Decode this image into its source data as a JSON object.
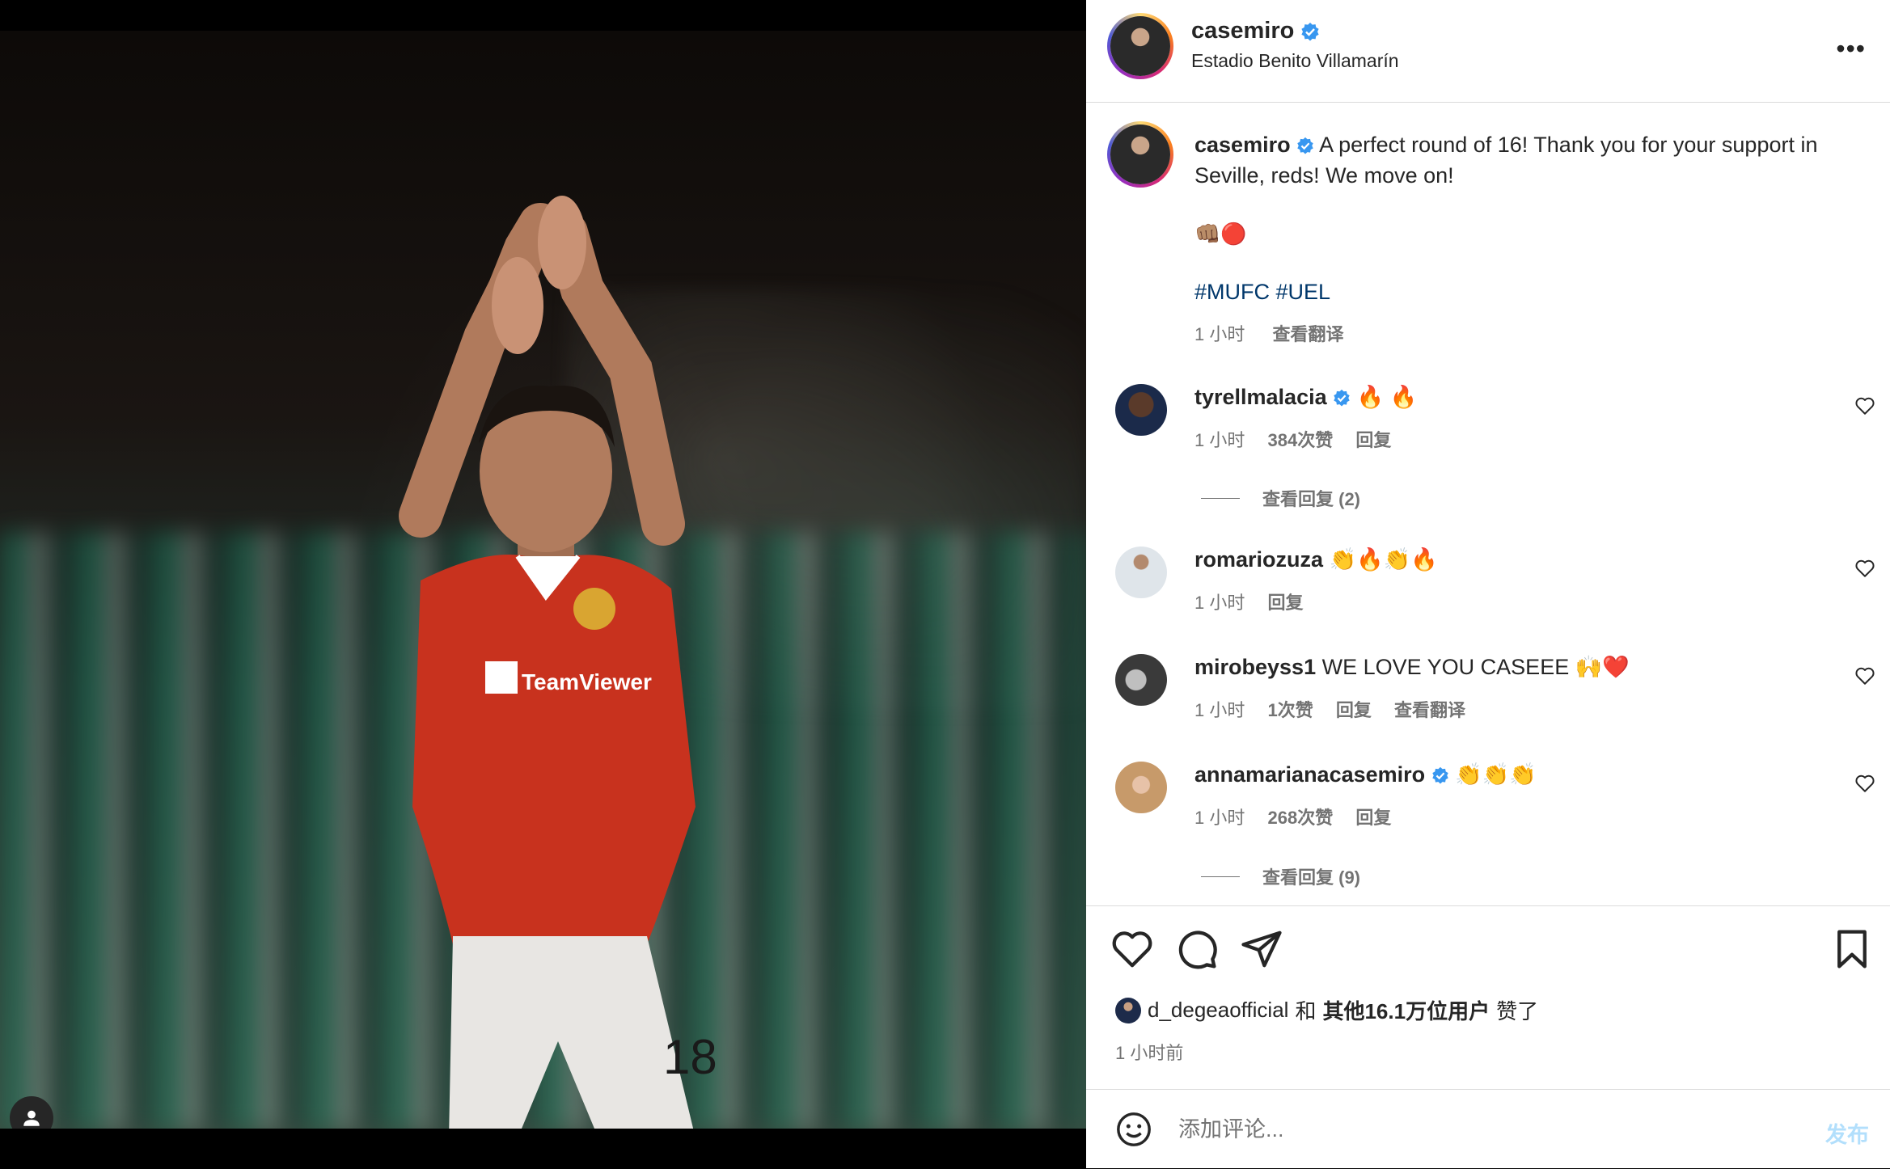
{
  "post": {
    "username": "casemiro",
    "location": "Estadio Benito Villamarín",
    "more_label": "•••",
    "caption": {
      "username": "casemiro",
      "text": "A perfect round of 16! Thank you for your support in Seville, reds! We move on!",
      "emoji": "👊🏽🔴",
      "hashtags": "#MUFC #UEL",
      "time": "1 小时",
      "translate": "查看翻译"
    }
  },
  "comments": [
    {
      "username": "tyrellmalacia",
      "verified": true,
      "text": "🔥 🔥",
      "time": "1 小时",
      "likes": "384次赞",
      "reply": "回复",
      "view_replies": "查看回复 (2)"
    },
    {
      "username": "romariozuza",
      "verified": false,
      "text": "👏🔥👏🔥",
      "time": "1 小时",
      "reply": "回复"
    },
    {
      "username": "mirobeyss1",
      "verified": false,
      "text": "WE LOVE YOU CASEEE 🙌❤️",
      "time": "1 小时",
      "likes": "1次赞",
      "reply": "回复",
      "translate": "查看翻译"
    },
    {
      "username": "annamarianacasemiro",
      "verified": true,
      "text": "👏👏👏",
      "time": "1 小时",
      "likes": "268次赞",
      "reply": "回复",
      "view_replies": "查看回复 (9)"
    }
  ],
  "likes": {
    "user": "d_degeaofficial",
    "and": "和",
    "others": "其他16.1万位用户",
    "suffix": "赞了"
  },
  "time_ago": "1 小时前",
  "comment_box": {
    "placeholder": "添加评论...",
    "post_label": "发布"
  },
  "colors": {
    "verified": "#3897f0",
    "link": "#00376b",
    "muted": "#737373",
    "post_disabled": "#b2dffc"
  }
}
